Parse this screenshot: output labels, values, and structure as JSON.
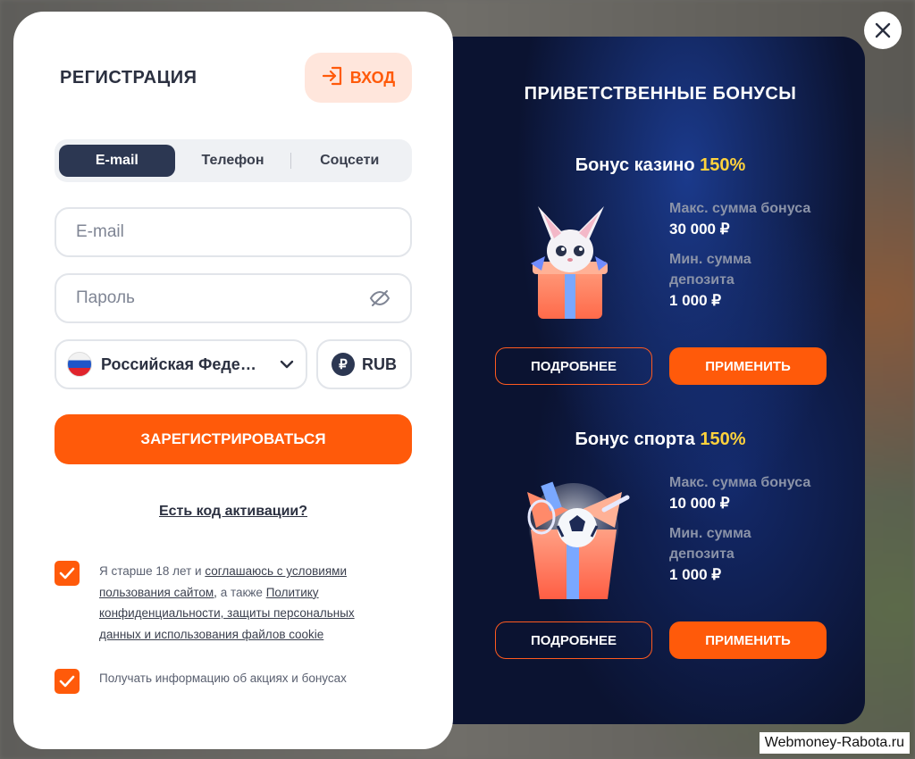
{
  "registration": {
    "title": "РЕГИСТРАЦИЯ",
    "login_label": "ВХОД",
    "tabs": [
      {
        "label": "E-mail",
        "active": true
      },
      {
        "label": "Телефон",
        "active": false
      },
      {
        "label": "Соцсети",
        "active": false
      }
    ],
    "email_placeholder": "E-mail",
    "password_placeholder": "Пароль",
    "country": "Российская Феде…",
    "currency": "RUB",
    "currency_symbol": "₽",
    "register_label": "ЗАРЕГИСТРИРОВАТЬСЯ",
    "activation_link": "Есть код активации?",
    "terms": {
      "checked": true,
      "text_1": "Я старше 18 лет и ",
      "link_1": "соглашаюсь с условиями пользования сайтом,",
      "text_2": " а также ",
      "link_2": "Политику конфиденциальности, защиты персональных данных и использования файлов cookie"
    },
    "promo": {
      "checked": true,
      "text": "Получать информацию об акциях и бонусах"
    }
  },
  "bonuses": {
    "title": "ПРИВЕТСТВЕННЫЕ БОНУСЫ",
    "items": [
      {
        "name": "Бонус казино",
        "percent": "150%",
        "max_label": "Макс. сумма бонуса",
        "max_value": "30 000 ₽",
        "min_label": "Мин. сумма депозита",
        "min_value": "1 000 ₽",
        "details_label": "ПОДРОБНЕЕ",
        "apply_label": "ПРИМЕНИТЬ",
        "image": "fox-gift-icon"
      },
      {
        "name": "Бонус спорта",
        "percent": "150%",
        "max_label": "Макс. сумма бонуса",
        "max_value": "10 000 ₽",
        "min_label": "Мин. сумма депозита",
        "min_value": "1 000 ₽",
        "details_label": "ПОДРОБНЕЕ",
        "apply_label": "ПРИМЕНИТЬ",
        "image": "sport-gift-icon"
      }
    ]
  },
  "watermark": "Webmoney-Rabota.ru",
  "colors": {
    "accent": "#ff5a0a",
    "dark_panel": "#0b1331",
    "highlight": "#ffd23c",
    "tab_active": "#2c3752"
  }
}
